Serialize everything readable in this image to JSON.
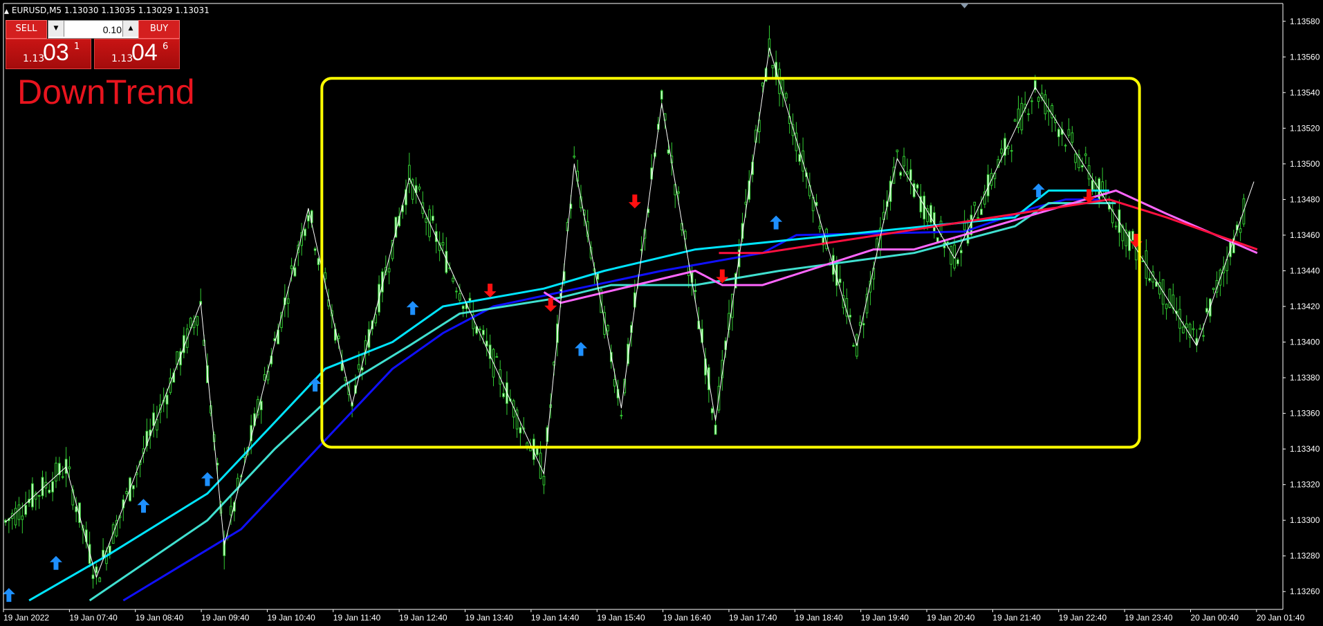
{
  "window": {
    "title": "EURUSD,M5  1.13030 1.13035 1.13029 1.13031"
  },
  "trade_panel": {
    "sell_label": "SELL",
    "buy_label": "BUY",
    "volume": "0.10",
    "sell_price": {
      "prefix": "1.13",
      "big": "03",
      "sup": "1"
    },
    "buy_price": {
      "prefix": "1.13",
      "big": "04",
      "sup": "6"
    }
  },
  "trend_label": "DownTrend",
  "colors": {
    "background": "#000000",
    "candle": "#32cd32",
    "candle_body": "#ccffcc",
    "zigzag": "#ffffff",
    "aqua_line": "#00e5ff",
    "teal_line": "#40e0d0",
    "blue_line": "#1010ff",
    "magenta_line": "#ff66ff",
    "red_line": "#ff1040",
    "up_arrow": "#1e90ff",
    "down_arrow": "#ff1010",
    "range_box": "#ffff00",
    "sell_button": "#d41f1f",
    "trend_text": "#e8141e"
  },
  "chart_data": {
    "type": "candlestick",
    "symbol": "EURUSD",
    "timeframe": "M5",
    "ylim": [
      1.1325,
      1.1359
    ],
    "y_ticks": [
      "1.13580",
      "1.13560",
      "1.13540",
      "1.13520",
      "1.13500",
      "1.13480",
      "1.13460",
      "1.13440",
      "1.13420",
      "1.13400",
      "1.13380",
      "1.13360",
      "1.13340",
      "1.13320",
      "1.13300",
      "1.13280",
      "1.13260"
    ],
    "x_ticks": [
      "19 Jan 2022",
      "19 Jan 07:40",
      "19 Jan 08:40",
      "19 Jan 09:40",
      "19 Jan 10:40",
      "19 Jan 11:40",
      "19 Jan 12:40",
      "19 Jan 13:40",
      "19 Jan 14:40",
      "19 Jan 15:40",
      "19 Jan 16:40",
      "19 Jan 17:40",
      "19 Jan 18:40",
      "19 Jan 19:40",
      "19 Jan 20:40",
      "19 Jan 21:40",
      "19 Jan 22:40",
      "19 Jan 23:40",
      "20 Jan 00:40",
      "20 Jan 01:40"
    ],
    "zigzag": [
      {
        "x": 0,
        "y": 1.13299
      },
      {
        "x": 18,
        "y": 1.1333
      },
      {
        "x": 27,
        "y": 1.13268
      },
      {
        "x": 58,
        "y": 1.13422
      },
      {
        "x": 65,
        "y": 1.13286
      },
      {
        "x": 90,
        "y": 1.13475
      },
      {
        "x": 103,
        "y": 1.13365
      },
      {
        "x": 120,
        "y": 1.13492
      },
      {
        "x": 160,
        "y": 1.13326
      },
      {
        "x": 169,
        "y": 1.135
      },
      {
        "x": 183,
        "y": 1.13363
      },
      {
        "x": 195,
        "y": 1.13534
      },
      {
        "x": 211,
        "y": 1.13356
      },
      {
        "x": 227,
        "y": 1.13565
      },
      {
        "x": 253,
        "y": 1.13398
      },
      {
        "x": 265,
        "y": 1.13503
      },
      {
        "x": 282,
        "y": 1.13447
      },
      {
        "x": 306,
        "y": 1.13543
      },
      {
        "x": 354,
        "y": 1.13398
      },
      {
        "x": 371,
        "y": 1.1349
      }
    ],
    "aqua_line": [
      {
        "x": 7,
        "y": 1.13255
      },
      {
        "x": 30,
        "y": 1.1328
      },
      {
        "x": 60,
        "y": 1.13315
      },
      {
        "x": 80,
        "y": 1.13355
      },
      {
        "x": 95,
        "y": 1.13385
      },
      {
        "x": 115,
        "y": 1.134
      },
      {
        "x": 130,
        "y": 1.1342
      },
      {
        "x": 160,
        "y": 1.1343
      },
      {
        "x": 178,
        "y": 1.1344
      },
      {
        "x": 205,
        "y": 1.13452
      },
      {
        "x": 300,
        "y": 1.1347
      },
      {
        "x": 310,
        "y": 1.13485
      },
      {
        "x": 328,
        "y": 1.13485
      }
    ],
    "teal_line": [
      {
        "x": 25,
        "y": 1.13255
      },
      {
        "x": 60,
        "y": 1.133
      },
      {
        "x": 80,
        "y": 1.1334
      },
      {
        "x": 100,
        "y": 1.13375
      },
      {
        "x": 120,
        "y": 1.13398
      },
      {
        "x": 135,
        "y": 1.13416
      },
      {
        "x": 165,
        "y": 1.13425
      },
      {
        "x": 180,
        "y": 1.13432
      },
      {
        "x": 205,
        "y": 1.13432
      },
      {
        "x": 230,
        "y": 1.1344
      },
      {
        "x": 270,
        "y": 1.1345
      },
      {
        "x": 300,
        "y": 1.13465
      },
      {
        "x": 310,
        "y": 1.13478
      },
      {
        "x": 330,
        "y": 1.13478
      }
    ],
    "blue_line": [
      {
        "x": 35,
        "y": 1.13255
      },
      {
        "x": 70,
        "y": 1.13295
      },
      {
        "x": 95,
        "y": 1.13345
      },
      {
        "x": 115,
        "y": 1.13385
      },
      {
        "x": 130,
        "y": 1.13405
      },
      {
        "x": 145,
        "y": 1.1342
      },
      {
        "x": 170,
        "y": 1.1343
      },
      {
        "x": 195,
        "y": 1.1344
      },
      {
        "x": 225,
        "y": 1.1345
      },
      {
        "x": 235,
        "y": 1.1346
      },
      {
        "x": 285,
        "y": 1.13462
      },
      {
        "x": 305,
        "y": 1.13475
      },
      {
        "x": 315,
        "y": 1.1348
      },
      {
        "x": 325,
        "y": 1.1348
      }
    ],
    "magenta_line": [
      {
        "x": 160,
        "y": 1.13428
      },
      {
        "x": 165,
        "y": 1.13422
      },
      {
        "x": 205,
        "y": 1.1344
      },
      {
        "x": 213,
        "y": 1.13432
      },
      {
        "x": 225,
        "y": 1.13432
      },
      {
        "x": 258,
        "y": 1.13452
      },
      {
        "x": 270,
        "y": 1.13452
      },
      {
        "x": 330,
        "y": 1.13485
      },
      {
        "x": 345,
        "y": 1.13472
      },
      {
        "x": 372,
        "y": 1.1345
      }
    ],
    "red_line": [
      {
        "x": 212,
        "y": 1.1345
      },
      {
        "x": 225,
        "y": 1.1345
      },
      {
        "x": 328,
        "y": 1.1348
      },
      {
        "x": 345,
        "y": 1.1347
      },
      {
        "x": 372,
        "y": 1.13452
      }
    ],
    "up_arrows": [
      {
        "x": 1,
        "y": 1.13262
      },
      {
        "x": 15,
        "y": 1.1328
      },
      {
        "x": 41,
        "y": 1.13312
      },
      {
        "x": 60,
        "y": 1.13327
      },
      {
        "x": 92,
        "y": 1.1338
      },
      {
        "x": 121,
        "y": 1.13423
      },
      {
        "x": 171,
        "y": 1.134
      },
      {
        "x": 229,
        "y": 1.13471
      },
      {
        "x": 307,
        "y": 1.13489
      }
    ],
    "down_arrows": [
      {
        "x": 144,
        "y": 1.13425
      },
      {
        "x": 162,
        "y": 1.13417
      },
      {
        "x": 187,
        "y": 1.13475
      },
      {
        "x": 213,
        "y": 1.13433
      },
      {
        "x": 322,
        "y": 1.13478
      },
      {
        "x": 336,
        "y": 1.13453
      }
    ],
    "range_box": {
      "x0": 94,
      "x1": 337,
      "y_top": 1.13548,
      "y_bottom": 1.13341
    }
  }
}
